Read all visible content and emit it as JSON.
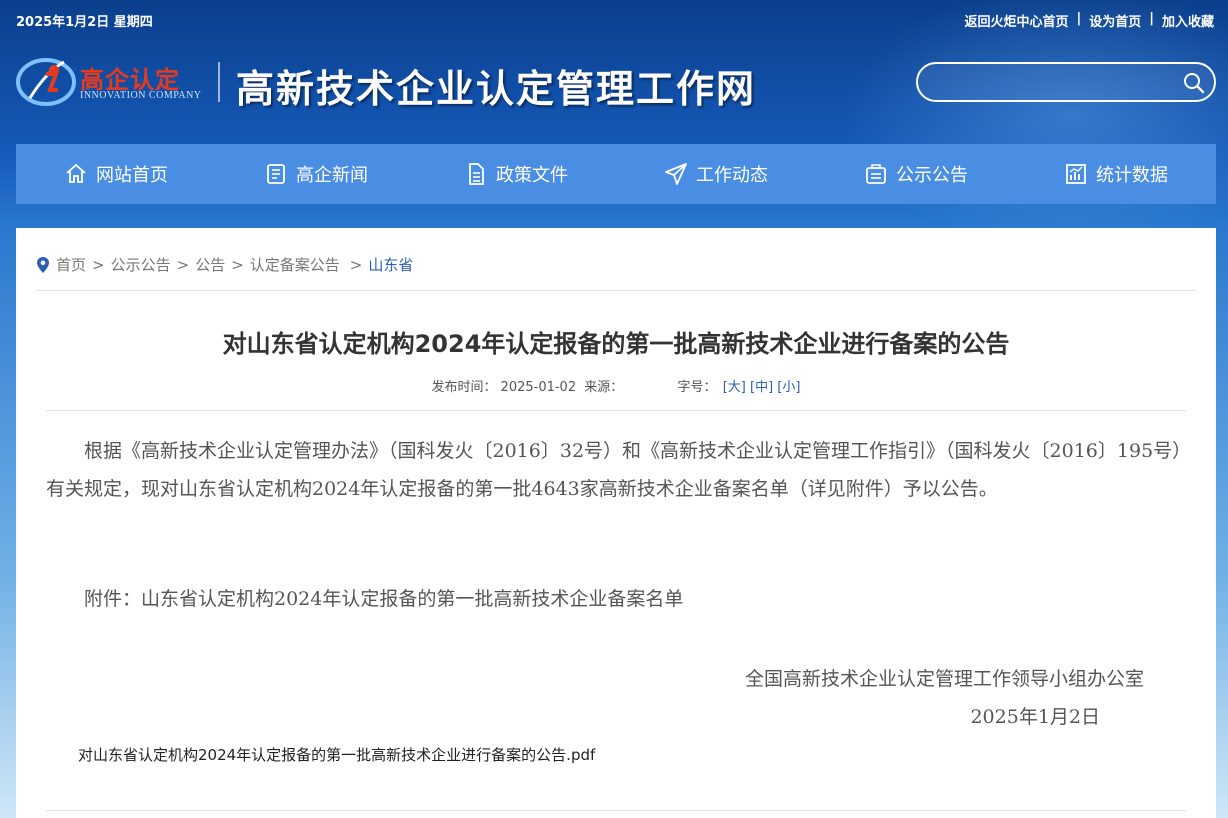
{
  "topbar": {
    "date": "2025年1月2日 星期四",
    "links": [
      "返回火炬中心首页",
      "设为首页",
      "加入收藏"
    ],
    "separator": "|"
  },
  "logo": {
    "cn": "高企认定",
    "en": "INNOVATION COMPANY"
  },
  "site_title": "高新技术企业认定管理工作网",
  "search": {
    "placeholder": "",
    "value": ""
  },
  "nav": [
    {
      "label": "网站首页",
      "icon": "home-icon"
    },
    {
      "label": "高企新闻",
      "icon": "news-icon"
    },
    {
      "label": "政策文件",
      "icon": "document-icon"
    },
    {
      "label": "工作动态",
      "icon": "paper-plane-icon"
    },
    {
      "label": "公示公告",
      "icon": "notice-icon"
    },
    {
      "label": "统计数据",
      "icon": "chart-icon"
    }
  ],
  "breadcrumb": {
    "items": [
      "首页",
      "公示公告",
      "公告",
      "认定备案公告"
    ],
    "current": "山东省",
    "separator": ">"
  },
  "article": {
    "title": "对山东省认定机构2024年认定报备的第一批高新技术企业进行备案的公告",
    "meta_publish_label": "发布时间：",
    "meta_publish_date": "2025-01-02",
    "meta_source_label": "来源：",
    "meta_fontsize_label": "字号：",
    "font_large": "[大]",
    "font_medium": "[中]",
    "font_small": "[小]",
    "body": "根据《高新技术企业认定管理办法》（国科发火〔2016〕32号）和《高新技术企业认定管理工作指引》（国科发火〔2016〕195号）有关规定，现对山东省认定机构2024年认定报备的第一批4643家高新技术企业备案名单（详见附件）予以公告。",
    "attachment_line": "附件：山东省认定机构2024年认定报备的第一批高新技术企业备案名单",
    "sign_org": "全国高新技术企业认定管理工作领导小组办公室",
    "sign_date": "2025年1月2日",
    "pdf_file": "对山东省认定机构2024年认定报备的第一批高新技术企业进行备案的公告.pdf"
  },
  "colors": {
    "nav_bg": "#4a8ee3",
    "header_bg": "#1459b8",
    "logo_red": "#e53b1c",
    "link_blue": "#2b5fb3"
  }
}
